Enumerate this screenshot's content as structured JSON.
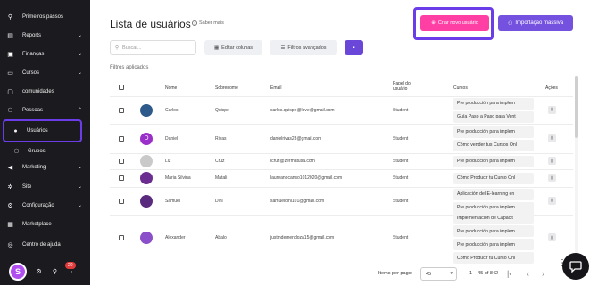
{
  "sidebar": {
    "items": [
      {
        "label": "Primeiros passos",
        "icon": "rocket-icon",
        "glyph": "⚲",
        "chev": ""
      },
      {
        "label": "Reports",
        "icon": "chart-icon",
        "glyph": "▤",
        "chev": "⌄"
      },
      {
        "label": "Finanças",
        "icon": "money-icon",
        "glyph": "▣",
        "chev": "⌄"
      },
      {
        "label": "Cursos",
        "icon": "book-icon",
        "glyph": "▭",
        "chev": "⌄"
      },
      {
        "label": "comunidades",
        "icon": "community-icon",
        "glyph": "▢",
        "chev": ""
      },
      {
        "label": "Pessoas",
        "icon": "people-icon",
        "glyph": "⚇",
        "chev": "⌃"
      },
      {
        "label": "Marketing",
        "icon": "megaphone-icon",
        "glyph": "◀",
        "chev": "⌄"
      },
      {
        "label": "Site",
        "icon": "gear-icon",
        "glyph": "✲",
        "chev": "⌄"
      },
      {
        "label": "Configuração",
        "icon": "settings-icon",
        "glyph": "⚙",
        "chev": "⌄"
      },
      {
        "label": "Marketplace",
        "icon": "store-icon",
        "glyph": "▦",
        "chev": ""
      },
      {
        "label": "Centro de ajuda",
        "icon": "help-icon",
        "glyph": "◎",
        "chev": ""
      }
    ],
    "sub_items": [
      {
        "label": "Usuários",
        "icon": "user-icon",
        "glyph": "●"
      },
      {
        "label": "Grupos",
        "icon": "group-icon",
        "glyph": "⚇"
      }
    ],
    "badge": "20"
  },
  "header": {
    "title": "Lista de usuários",
    "help_link": "Saber mais",
    "create_button": "Criar novo usuário",
    "import_button": "Importação massiva"
  },
  "toolbar": {
    "search_placeholder": "Buscar...",
    "edit_columns": "Editar colunas",
    "advanced_filters": "Filtros avançados"
  },
  "filters_label": "Filtros aplicados",
  "table": {
    "headers": {
      "name": "Nome",
      "surname": "Sobrenome",
      "email": "Email",
      "role": "Papel do usuário",
      "courses": "Cursos",
      "actions": "Ações"
    },
    "rows": [
      {
        "name": "Carlos",
        "surname": "Quispe",
        "email": "carlos.quispe@love@gmail.com",
        "role": "Student",
        "avatar_color": "#2d5a8a",
        "avatar_letter": "",
        "courses": [
          "Pre producción para implem",
          "Guía Paso a Paso para Vent"
        ]
      },
      {
        "name": "Daniel",
        "surname": "Rivas",
        "email": "danielrivas23@gmail.com",
        "role": "Student",
        "avatar_color": "#9b2fc9",
        "avatar_letter": "D",
        "courses": [
          "Pre producción para implem",
          "Cómo vender tus Cursos Onl"
        ]
      },
      {
        "name": "Liz",
        "surname": "Cruz",
        "email": "lcruz@zermatusa.com",
        "role": "Student",
        "avatar_color": "#c9c9c9",
        "avatar_letter": "",
        "courses": [
          "Pre producción para implem"
        ]
      },
      {
        "name": "Maria Silvina",
        "surname": "Matali",
        "email": "laureanocanso1012020@gmail.com",
        "role": "Student",
        "avatar_color": "#6b2d8f",
        "avatar_letter": "",
        "courses": [
          "Cómo Producir tu Curso Onl"
        ]
      },
      {
        "name": "Samuel",
        "surname": "Dini",
        "email": "samueldini101@gmail.com",
        "role": "Student",
        "avatar_color": "#5a2a7f",
        "avatar_letter": "",
        "courses": [
          "Aplicación del E-learning en",
          "Pre producción para implem"
        ]
      },
      {
        "name": "Alexander",
        "surname": "Abalo",
        "email": "justindemendoza15@gmail.com",
        "role": "Student",
        "avatar_color": "#8a4fc9",
        "avatar_letter": "",
        "courses": [
          "Implementación de Capacit",
          "Pre producción para implem",
          "Pre producción para implem",
          "Cómo Producir tu Curso Onl"
        ]
      }
    ]
  },
  "pagination": {
    "items_per_page_label": "Items per page:",
    "items_per_page_value": "45",
    "range": "1 – 45 of 842"
  }
}
